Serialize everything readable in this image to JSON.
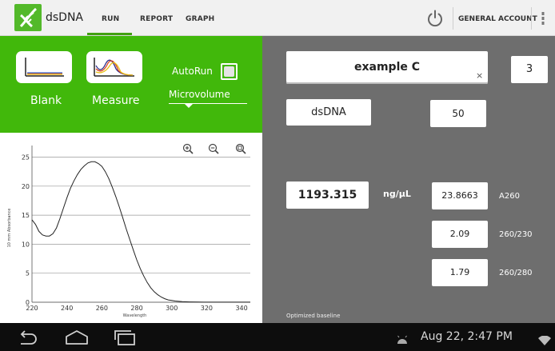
{
  "app": {
    "title": "dsDNA"
  },
  "tabs": [
    {
      "label": "RUN",
      "active": true
    },
    {
      "label": "REPORT",
      "active": false
    },
    {
      "label": "GRAPH",
      "active": false
    }
  ],
  "header": {
    "account_label": "GENERAL ACCOUNT",
    "icons": [
      "power-icon",
      "menu-icon"
    ]
  },
  "left_panel": {
    "blank_label": "Blank",
    "measure_label": "Measure",
    "autorun_label": "AutoRun",
    "autorun_checked": false,
    "mode_selected": "Microvolume"
  },
  "colors": {
    "accent_green": "#41b80b",
    "panel_grey": "#6e6e6e",
    "tab_indicator": "#42a012"
  },
  "chart_data": {
    "type": "line",
    "xlabel": "Wavelength",
    "ylabel": "10 mm Absorbance",
    "xlim": [
      220,
      345
    ],
    "ylim": [
      0,
      27
    ],
    "x_ticks": [
      220,
      240,
      260,
      280,
      300,
      320,
      340
    ],
    "y_ticks": [
      0,
      5,
      10,
      15,
      20,
      25
    ],
    "grid": "horizontal",
    "series": [
      {
        "x": [
          220,
          222,
          224,
          226,
          228,
          230,
          232,
          234,
          236,
          238,
          240,
          242,
          244,
          246,
          248,
          250,
          252,
          254,
          256,
          258,
          260,
          262,
          264,
          266,
          268,
          270,
          272,
          274,
          276,
          278,
          280,
          282,
          284,
          286,
          288,
          290,
          292,
          294,
          296,
          298,
          300,
          302,
          304,
          306,
          310,
          315,
          320,
          325,
          330,
          335,
          340,
          345
        ],
        "y": [
          14.2,
          13.4,
          12.2,
          11.6,
          11.4,
          11.4,
          11.8,
          12.8,
          14.4,
          16.2,
          18.0,
          19.6,
          20.9,
          22.0,
          22.9,
          23.5,
          24.0,
          24.2,
          24.2,
          23.9,
          23.4,
          22.5,
          21.3,
          19.8,
          18.2,
          16.4,
          14.5,
          12.6,
          10.8,
          9.0,
          7.3,
          5.8,
          4.5,
          3.4,
          2.5,
          1.8,
          1.3,
          0.9,
          0.6,
          0.4,
          0.3,
          0.2,
          0.15,
          0.1,
          0.05,
          0.03,
          0.02,
          0.02,
          0.02,
          0.02,
          0.02,
          0.02
        ]
      }
    ]
  },
  "chart_tools": {
    "icons": [
      "zoom-in-icon",
      "zoom-out-icon",
      "zoom-fit-icon"
    ]
  },
  "sample": {
    "name": "example C",
    "clear_glyph": "×",
    "count": "3",
    "type": "dsDNA",
    "factor": "50"
  },
  "results": {
    "concentration": "1193.315",
    "concentration_unit": "ng/µL",
    "metrics": [
      {
        "value": "23.8663",
        "label": "A260"
      },
      {
        "value": "2.09",
        "label": "260/230"
      },
      {
        "value": "1.79",
        "label": "260/280"
      }
    ],
    "note": "Optimized baseline"
  },
  "system_bar": {
    "datetime": "Aug 22, 2:47 PM",
    "icons": [
      "back-icon",
      "home-icon",
      "recents-icon",
      "android-icon",
      "wifi-icon"
    ]
  }
}
